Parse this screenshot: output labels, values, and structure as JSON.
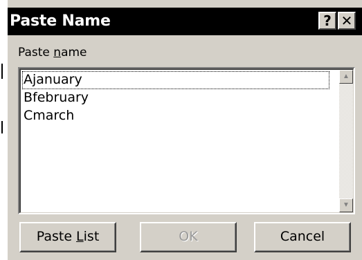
{
  "dialog": {
    "title": "Paste Name",
    "help_glyph": "?",
    "close_glyph": "✕",
    "label_prefix": "Paste ",
    "label_underlined": "n",
    "label_suffix": "ame"
  },
  "list": {
    "items": [
      "Ajanuary",
      "Bfebruary",
      "Cmarch"
    ],
    "selected_index": 0
  },
  "scrollbar": {
    "up_icon": "up-arrow",
    "down_icon": "down-arrow",
    "up_glyph": "▲",
    "down_glyph": "▼"
  },
  "buttons": {
    "paste_list_prefix": "Paste ",
    "paste_list_underlined": "L",
    "paste_list_suffix": "ist",
    "ok": "OK",
    "cancel": "Cancel"
  },
  "colors": {
    "titlebar": "#000000",
    "dialog_bg": "#d4d0c8",
    "list_bg": "#ffffff",
    "disabled_text": "#9a9a9a"
  }
}
